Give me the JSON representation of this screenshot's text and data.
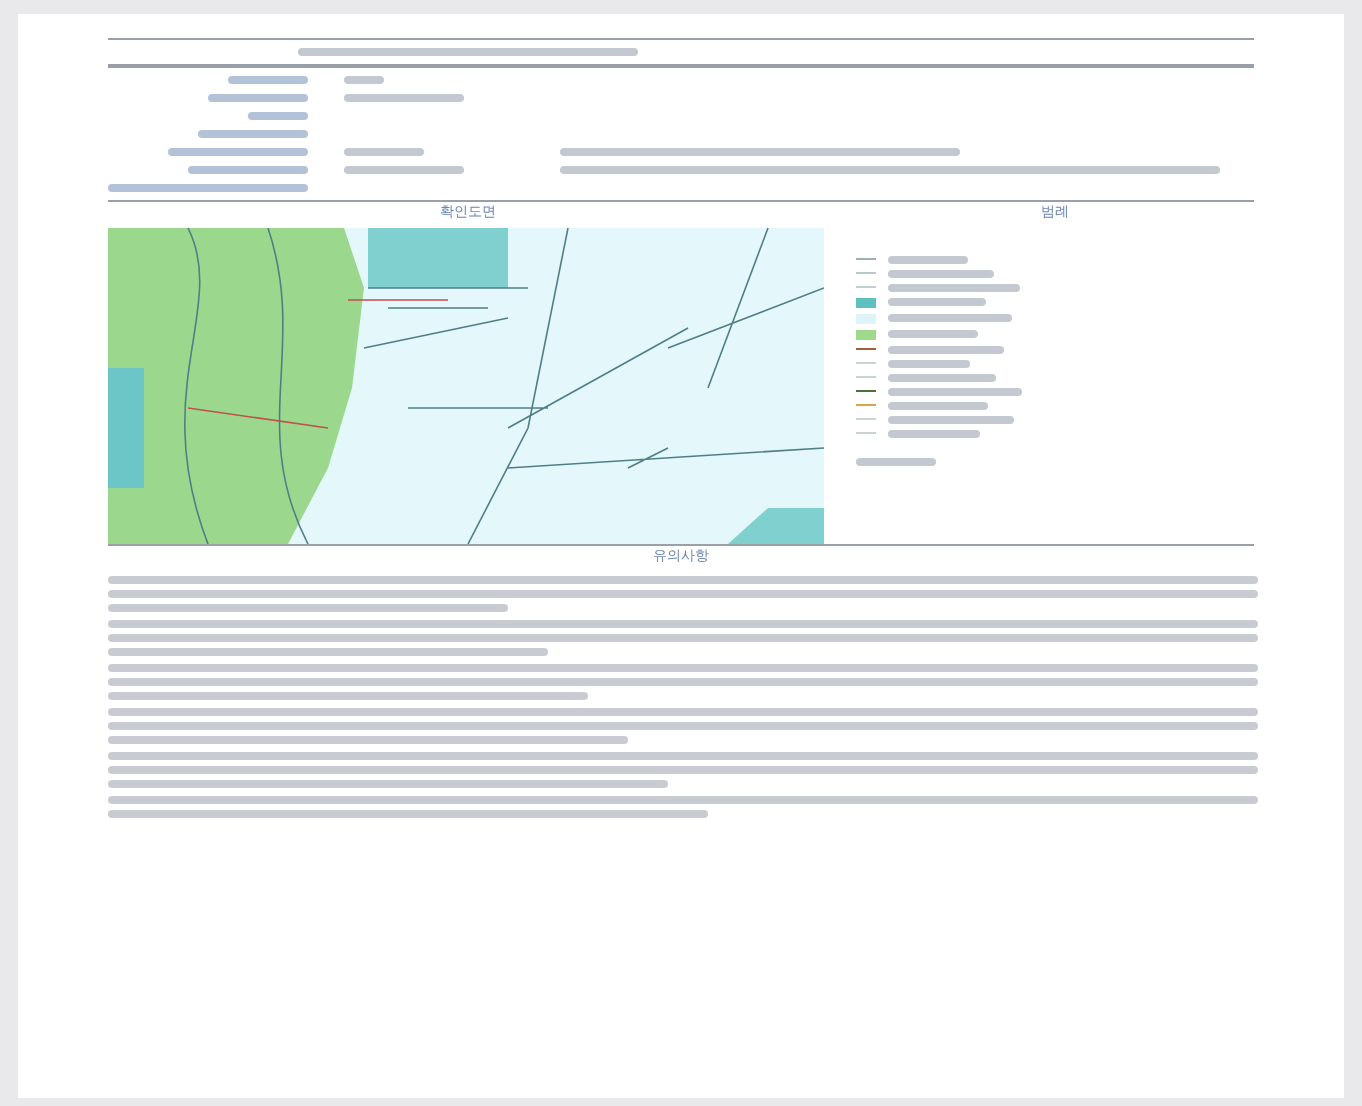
{
  "header": {
    "form_line": {
      "kind": "illegible"
    }
  },
  "info_rows": [
    {
      "kind": "illegible"
    },
    {
      "kind": "illegible"
    },
    {
      "kind": "illegible"
    },
    {
      "kind": "illegible"
    },
    {
      "kind": "illegible"
    },
    {
      "kind": "illegible"
    },
    {
      "kind": "illegible"
    }
  ],
  "map_section": {
    "title": "확인도면",
    "legend_title": "범례",
    "legend": [
      {
        "kind": "line",
        "color": "#9ab0b0"
      },
      {
        "kind": "line",
        "color": "#b8c8c8"
      },
      {
        "kind": "line",
        "color": "#c0d0d0"
      },
      {
        "kind": "fill",
        "color": "#5fc0c2"
      },
      {
        "kind": "fill",
        "color": "#dff4f8"
      },
      {
        "kind": "fill",
        "color": "#9fd98c"
      },
      {
        "kind": "line",
        "color": "#a0603a"
      },
      {
        "kind": "line",
        "color": "#c8d4d4"
      },
      {
        "kind": "line",
        "color": "#c8d4d4"
      },
      {
        "kind": "line",
        "color": "#50703a"
      },
      {
        "kind": "line",
        "color": "#d8a848"
      },
      {
        "kind": "line",
        "color": "#c8d4d4"
      },
      {
        "kind": "line",
        "color": "#c8d4d4"
      }
    ],
    "scale": {
      "kind": "illegible"
    }
  },
  "notes": {
    "title": "유의사항",
    "paragraphs": [
      {
        "kind": "illegible"
      },
      {
        "kind": "illegible"
      },
      {
        "kind": "illegible"
      },
      {
        "kind": "illegible"
      },
      {
        "kind": "illegible"
      },
      {
        "kind": "illegible"
      }
    ]
  }
}
